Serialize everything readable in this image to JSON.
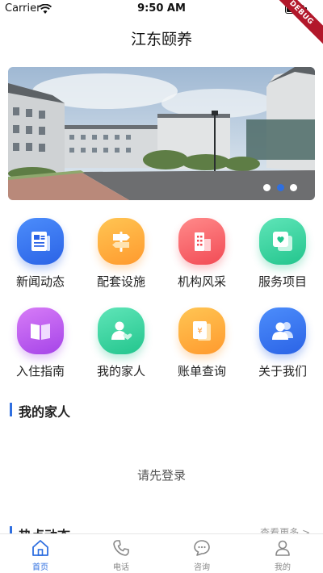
{
  "status": {
    "carrier": "Carrier",
    "time": "9:50 AM"
  },
  "debug_banner": "DEBUG",
  "header": {
    "title": "江东颐养"
  },
  "banner": {
    "slide_count": 3,
    "active_index": 1
  },
  "menu": [
    {
      "label": "新闻动态",
      "icon": "news-icon",
      "colors": [
        "#4c8dfb",
        "#2b63e6"
      ]
    },
    {
      "label": "配套设施",
      "icon": "signpost-icon",
      "colors": [
        "#ffc553",
        "#ff9a2e"
      ]
    },
    {
      "label": "机构风采",
      "icon": "building-icon",
      "colors": [
        "#ff8a8a",
        "#f24b55"
      ]
    },
    {
      "label": "服务项目",
      "icon": "heart-card-icon",
      "colors": [
        "#5fe5b8",
        "#23c58d"
      ]
    },
    {
      "label": "入住指南",
      "icon": "book-icon",
      "colors": [
        "#d77cf7",
        "#a544e8"
      ]
    },
    {
      "label": "我的家人",
      "icon": "family-icon",
      "colors": [
        "#5fe5b8",
        "#23c58d"
      ]
    },
    {
      "label": "账单查询",
      "icon": "bill-icon",
      "colors": [
        "#ffc553",
        "#ff9a2e"
      ]
    },
    {
      "label": "关于我们",
      "icon": "people-icon",
      "colors": [
        "#4c8dfb",
        "#2b63e6"
      ]
    }
  ],
  "family_section": {
    "title": "我的家人",
    "login_hint": "请先登录"
  },
  "hot_section": {
    "title": "热点动态",
    "more": "查看更多 >"
  },
  "tabs": [
    {
      "label": "首页",
      "icon": "home-icon",
      "active": true
    },
    {
      "label": "电话",
      "icon": "phone-icon",
      "active": false
    },
    {
      "label": "咨询",
      "icon": "chat-icon",
      "active": false
    },
    {
      "label": "我的",
      "icon": "profile-icon",
      "active": false
    }
  ],
  "colors": {
    "accent": "#2f6fe0",
    "debug": "#b2182b"
  }
}
